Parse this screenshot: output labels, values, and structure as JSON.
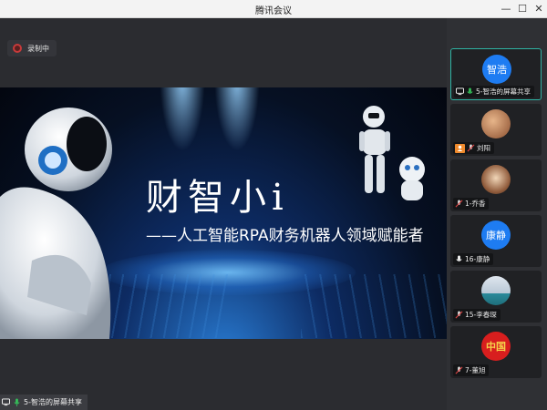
{
  "window": {
    "title": "腾讯会议",
    "minimize": "—",
    "maximize": "☐",
    "close": "✕"
  },
  "recording": {
    "label": "录制中"
  },
  "slide": {
    "headline": "财智小i",
    "subline": "——人工智能RPA财务机器人领域赋能者"
  },
  "share": {
    "label": "5-智浩的屏幕共享"
  },
  "participants": [
    {
      "name": "5-智浩的屏幕共享",
      "avatar_text": "智浩",
      "avatar_color": "#1e7cf2",
      "active": true,
      "icons": [
        "screen-share-icon",
        "mic-on-icon"
      ]
    },
    {
      "name": "刘阳",
      "avatar_text": "",
      "avatar_color": "#c28a5c",
      "active": false,
      "icons": [
        "user-badge-icon",
        "mic-muted-icon"
      ]
    },
    {
      "name": "1-乔香",
      "avatar_text": "",
      "avatar_color": "#e8c9a0",
      "active": false,
      "icons": [
        "mic-muted-icon"
      ]
    },
    {
      "name": "16-康静",
      "avatar_text": "康静",
      "avatar_color": "#1e7cf2",
      "active": false,
      "icons": [
        "mic-on-icon"
      ]
    },
    {
      "name": "15-李春琛",
      "avatar_text": "",
      "avatar_color": "#dfe6ee",
      "active": false,
      "icons": [
        "mic-muted-icon"
      ]
    },
    {
      "name": "7-董旭",
      "avatar_text": "中国",
      "avatar_color": "#d81e1e",
      "active": false,
      "icons": [
        "mic-muted-icon"
      ]
    }
  ],
  "colors": {
    "accent": "#2fb4a4",
    "mic_on": "#35c25a",
    "recording": "#c73a3a"
  }
}
